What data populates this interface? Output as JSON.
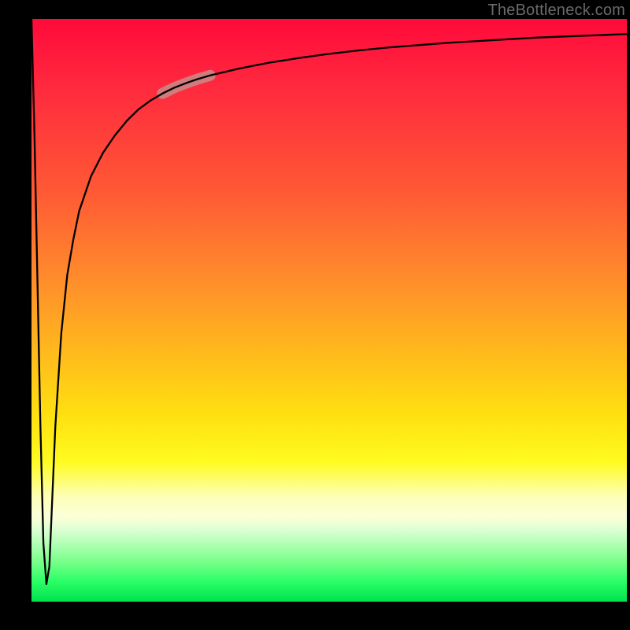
{
  "watermark": "TheBottleneck.com",
  "chart_data": {
    "type": "line",
    "title": "",
    "xlabel": "",
    "ylabel": "",
    "xlim": [
      0,
      100
    ],
    "ylim": [
      0,
      100
    ],
    "grid": false,
    "legend": false,
    "notes": "Axes are unlabeled; values are normalized 0–100 estimates from pixel geometry. Background gradient encodes a vertical spectrum from red (top) to green (bottom). A short translucent highlight overlays the curve near x≈22–30.",
    "series": [
      {
        "name": "bottleneck-curve",
        "x": [
          0,
          0.5,
          1,
          1.5,
          2,
          2.5,
          3,
          3.5,
          4,
          5,
          6,
          7,
          8,
          10,
          12,
          14,
          16,
          18,
          20,
          22,
          24,
          26,
          28,
          30,
          35,
          40,
          45,
          50,
          55,
          60,
          65,
          70,
          75,
          80,
          85,
          90,
          95,
          100
        ],
        "y": [
          100,
          80,
          55,
          30,
          10,
          3,
          6,
          18,
          30,
          46,
          56,
          62,
          67,
          73,
          77,
          80,
          82.5,
          84.5,
          86,
          87.2,
          88.2,
          89,
          89.7,
          90.3,
          91.5,
          92.5,
          93.3,
          94,
          94.6,
          95.1,
          95.5,
          95.9,
          96.2,
          96.5,
          96.8,
          97,
          97.2,
          97.4
        ]
      },
      {
        "name": "highlight-segment",
        "x": [
          22,
          24,
          26,
          28,
          30
        ],
        "y": [
          87.2,
          88.2,
          89,
          89.7,
          90.3
        ]
      }
    ]
  }
}
